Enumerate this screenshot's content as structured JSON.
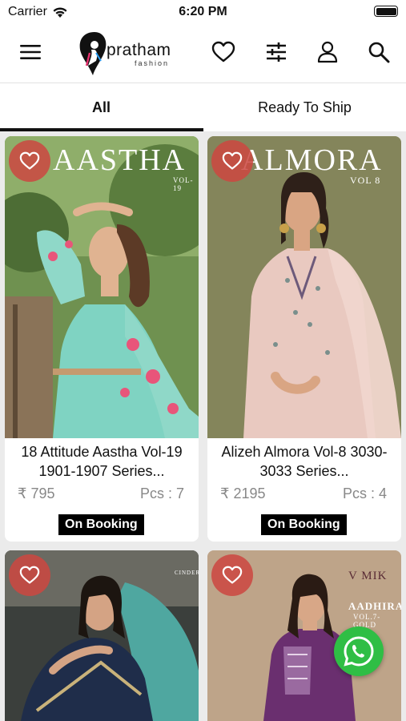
{
  "status_bar": {
    "carrier": "Carrier",
    "time": "6:20 PM"
  },
  "header": {
    "logo_text": "pratham",
    "logo_sub": "fashion",
    "icons": [
      "menu-icon",
      "heart-icon",
      "filter-icon",
      "user-icon",
      "search-icon"
    ]
  },
  "tabs": [
    {
      "label": "All",
      "active": true
    },
    {
      "label": "Ready To Ship",
      "active": false
    }
  ],
  "products": [
    {
      "brand": "AASTHA",
      "brand_sub": "VOL-19",
      "name": "18 Attitude Aastha Vol-19 1901-1907 Series...",
      "price": "₹ 795",
      "pcs": "Pcs : 7",
      "status": "On Booking"
    },
    {
      "brand": "ALMORA",
      "brand_sub": "VOL 8",
      "name": "Alizeh Almora Vol-8 3030-3033 Series...",
      "price": "₹ 2195",
      "pcs": "Pcs : 4",
      "status": "On Booking"
    },
    {
      "brand": "CINDERELLA"
    },
    {
      "brand": "V MIK",
      "brand_sub": "AADHIRA",
      "brand_sub2": "VOL.7-GOLD"
    }
  ],
  "colors": {
    "accent_red": "#cd4641",
    "whatsapp_green": "#2fbe45",
    "badge_black": "#000000"
  }
}
